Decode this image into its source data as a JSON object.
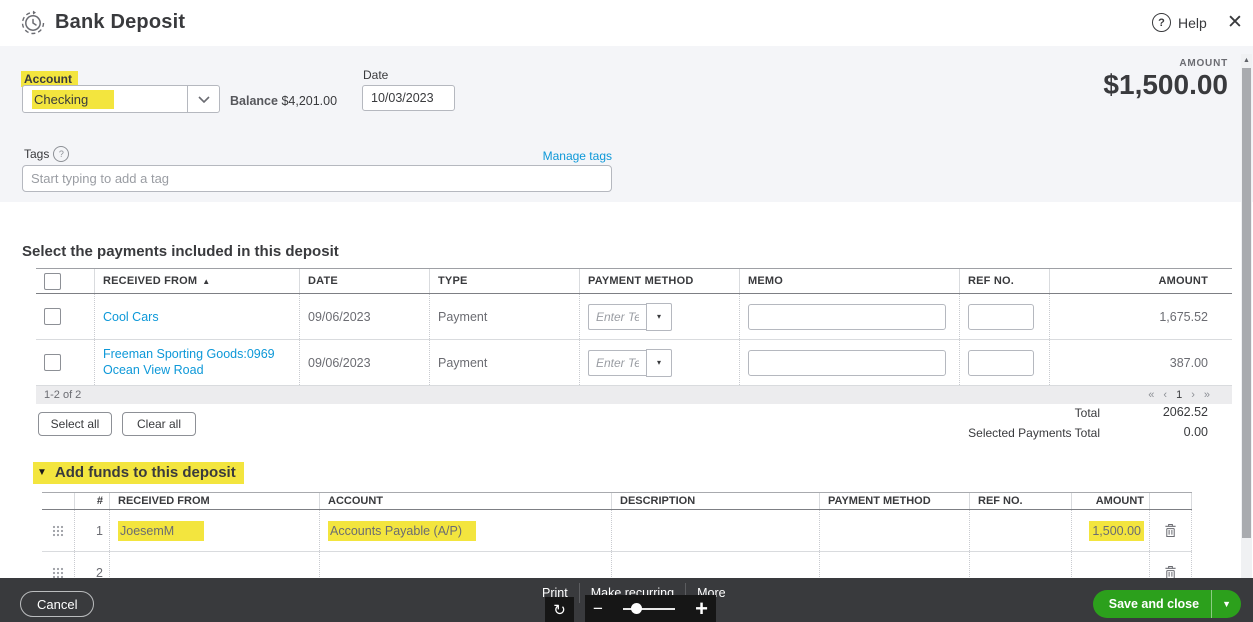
{
  "window": {
    "title": "Bank Deposit",
    "help_label": "Help"
  },
  "deposit_form": {
    "account_label": "Account",
    "account_value": "Checking",
    "balance_label": "Balance",
    "balance_value": "$4,201.00",
    "date_label": "Date",
    "date_value": "10/03/2023",
    "amount_label": "AMOUNT",
    "amount_value": "$1,500.00",
    "tags_label": "Tags",
    "manage_tags_label": "Manage tags",
    "tags_placeholder": "Start typing to add a tag"
  },
  "payments": {
    "heading": "Select the payments included in this deposit",
    "columns": {
      "received_from": "RECEIVED FROM",
      "date": "DATE",
      "type": "TYPE",
      "payment_method": "PAYMENT METHOD",
      "memo": "MEMO",
      "ref_no": "REF NO.",
      "amount": "AMOUNT"
    },
    "rows": [
      {
        "received_from": "Cool Cars",
        "date": "09/06/2023",
        "type": "Payment",
        "payment_method_placeholder": "Enter Text",
        "amount": "1,675.52"
      },
      {
        "received_from": "Freeman Sporting Goods:0969 Ocean View Road",
        "date": "09/06/2023",
        "type": "Payment",
        "payment_method_placeholder": "Enter Text",
        "amount": "387.00"
      }
    ],
    "pagination": {
      "range_label": "1-2 of 2",
      "first": "«",
      "prev": "‹",
      "current_page": "1",
      "next": "›",
      "last": "»"
    },
    "select_all_label": "Select all",
    "clear_all_label": "Clear all",
    "total_label": "Total",
    "total_value": "2062.52",
    "selected_total_label": "Selected Payments Total",
    "selected_total_value": "0.00"
  },
  "add_funds": {
    "heading": "Add funds to this deposit",
    "columns": {
      "number": "#",
      "received_from": "RECEIVED FROM",
      "account": "ACCOUNT",
      "description": "DESCRIPTION",
      "payment_method": "PAYMENT METHOD",
      "ref_no": "REF NO.",
      "amount": "AMOUNT"
    },
    "rows": [
      {
        "number": "1",
        "received_from": "JoesemM",
        "account": "Accounts Payable (A/P)",
        "amount": "1,500.00"
      },
      {
        "number": "2",
        "received_from": "",
        "account": "",
        "amount": ""
      }
    ]
  },
  "footer": {
    "cancel_label": "Cancel",
    "print_label": "Print",
    "make_recurring_label": "Make recurring",
    "more_label": "More",
    "save_label": "Save and close"
  },
  "icons": {
    "help_glyph": "?",
    "tags_help_glyph": "?",
    "close_glyph": "✕",
    "sort_asc_glyph": "▲",
    "dropdown_glyph": "▾",
    "collapse_glyph": "▼",
    "scroll_up_glyph": "▲",
    "refresh_glyph": "↻",
    "zoom_out_glyph": "−",
    "zoom_in_glyph": "+"
  },
  "colors": {
    "highlight_yellow": "#f3e53e",
    "link_blue": "#0d98d8",
    "accent_green": "#2ca01c",
    "footer_bar": "#393a3d",
    "panel_gray": "#f4f5f8"
  }
}
